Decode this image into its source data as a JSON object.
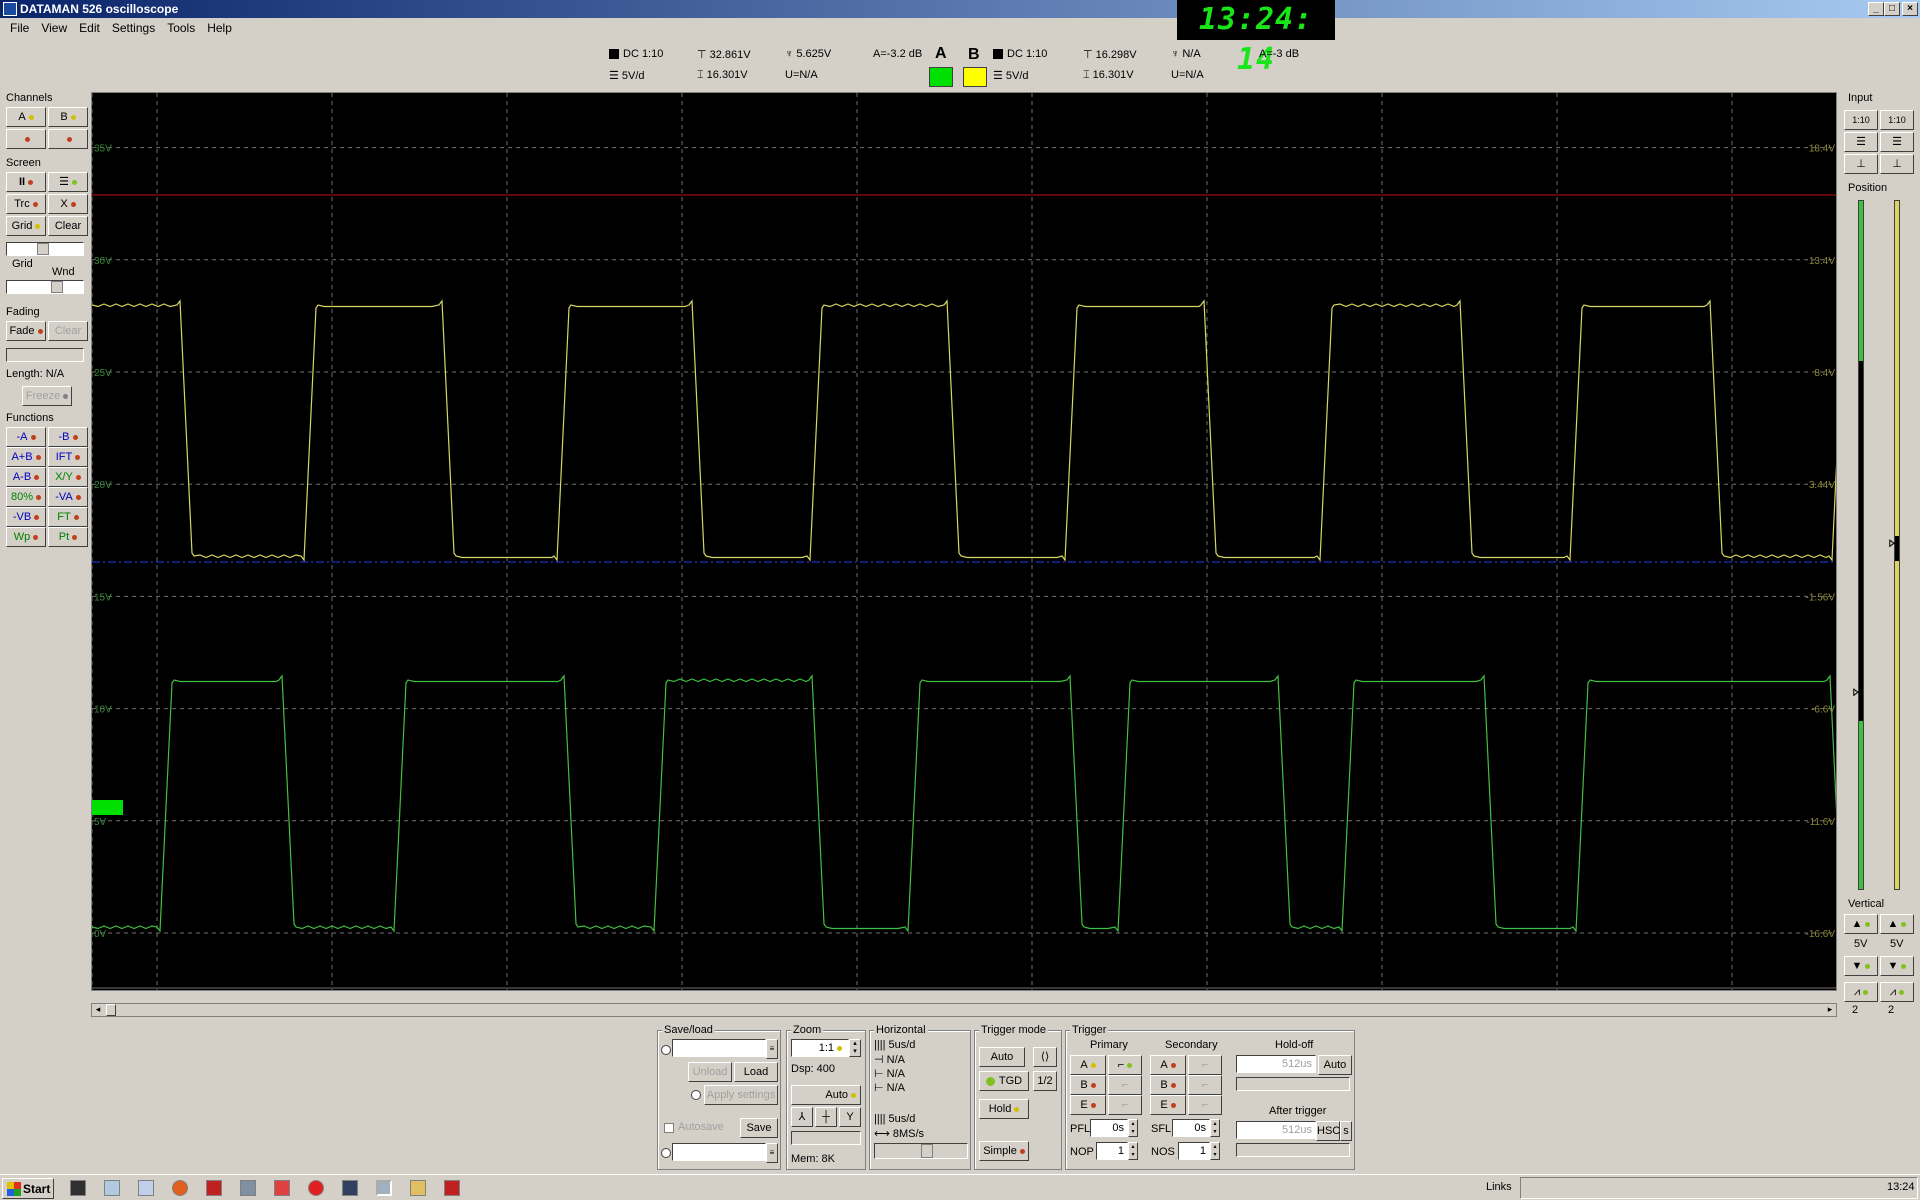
{
  "window": {
    "title": "DATAMAN 526 oscilloscope",
    "clock": "13:24: 14"
  },
  "menu": [
    "File",
    "View",
    "Edit",
    "Settings",
    "Tools",
    "Help"
  ],
  "chA": {
    "coupling": "DC 1:10",
    "vdiv": "5V/d",
    "max": "32.861V",
    "span": "16.301V",
    "rms": "5.625V",
    "u": "U=N/A",
    "atten": "A=-3.2 dB",
    "letter": "A",
    "color": "#00e000"
  },
  "chB": {
    "letter": "B",
    "coupling": "DC 1:10",
    "vdiv": "5V/d",
    "max": "16.298V",
    "span": "16.301V",
    "rms": "N/A",
    "u": "U=N/A",
    "atten": "A=-3 dB",
    "color": "#ffff00"
  },
  "left": {
    "channels": "Channels",
    "a": "A",
    "b": "B",
    "screen": "Screen",
    "pause": "II",
    "trc": "Trc",
    "x": "X",
    "grid": "Grid",
    "clear": "Clear",
    "grid2": "Grid",
    "wnd": "Wnd",
    "fading": "Fading",
    "fade": "Fade",
    "clear2": "Clear",
    "length": "Length: N/A",
    "freeze": "Freeze",
    "functions": "Functions",
    "fn": [
      "-A",
      "-B",
      "A+B",
      "IFT",
      "A-B",
      "X/Y",
      "80%",
      "-VA",
      "-VB",
      "FT",
      "Wp",
      "Pt"
    ]
  },
  "right": {
    "input": "Input",
    "r1": "1:10",
    "r2": "1:10",
    "position": "Position",
    "vertical": "Vertical",
    "v1": "5V",
    "v2": "5V",
    "p1": "2",
    "p2": "2"
  },
  "axisLeft": [
    "35V",
    "30V",
    "25V",
    "20V",
    "15V",
    "10V",
    "5V",
    "0V"
  ],
  "axisRight": [
    "18.4V",
    "13.4V",
    "8.4V",
    "3.44V",
    "-1.56V",
    "-6.6V",
    "-11.6V",
    "-16.6V"
  ],
  "bottom": {
    "saveload": "Save/load",
    "unload": "Unload",
    "load": "Load",
    "apply": "Apply settings",
    "autosave": "Autosave",
    "save": "Save",
    "zoom": "Zoom",
    "zoomval": "1:1",
    "dsp": "Dsp:  400",
    "auto": "Auto",
    "mem": "Mem: 8K",
    "horizontal": "Horizontal",
    "h1": "5us/d",
    "h2": "N/A",
    "h3": "N/A",
    "h4": "N/A",
    "h5": "5us/d",
    "h6": "8MS/s",
    "trigmode": "Trigger mode",
    "tauto": "Auto",
    "tgd": "TGD",
    "half": "1/2",
    "hold": "Hold",
    "simple": "Simple",
    "trigger": "Trigger",
    "primary": "Primary",
    "secondary": "Secondary",
    "holdoff": "Hold-off",
    "hoval": "512us",
    "hauto": "Auto",
    "pa": "A",
    "pb": "B",
    "pe": "E",
    "sa": "A",
    "sb": "B",
    "se": "E",
    "pfl": "PFL",
    "pflv": "0s",
    "sfl": "SFL",
    "sflv": "0s",
    "after": "After trigger",
    "atval": "512us",
    "hsc": "HSC",
    "s": "s",
    "nop": "NOP",
    "nopv": "1",
    "nos": "NOS",
    "nosv": "1"
  },
  "taskbar": {
    "start": "Start",
    "links": "Links",
    "time": "13:24"
  }
}
